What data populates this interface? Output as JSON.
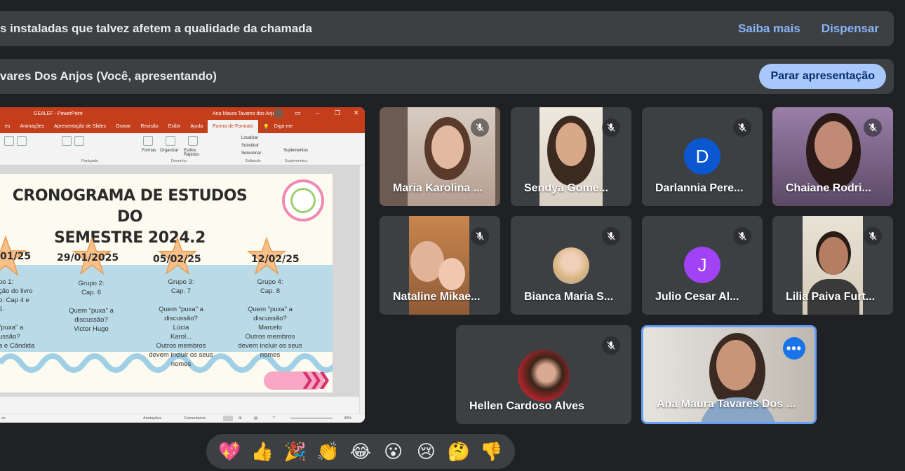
{
  "banner": {
    "message": "s instaladas que talvez afetem a qualidade da chamada",
    "learn_more": "Saiba mais",
    "dismiss": "Dispensar"
  },
  "presentation": {
    "presenter": "vares Dos Anjos (Você, apresentando)",
    "stop_label": "Parar apresentação"
  },
  "shared_screen": {
    "app_title": "GEALEF - PowerPoint",
    "user": "Ana Maura Tavares dos Anjos",
    "menu": [
      "es",
      "Animações",
      "Apresentação de Slides",
      "Gravar",
      "Revisão",
      "Exibir",
      "Ajuda",
      "Forma de Formato",
      "Diga-me"
    ],
    "ribbon_groups": [
      "Parágrafo",
      "Desenho",
      "Editando",
      "Suplementos"
    ],
    "ribbon_labels": {
      "formas": "Formas",
      "organizar": "Organizar",
      "estilos": "Estilos Rápidos",
      "localizar": "Localizar",
      "substituir": "Substituir",
      "selecionar": "Selecionar",
      "suplementos": "Suplementos"
    },
    "slide": {
      "title_line1": "CRONOGRAMA DE ESTUDOS DO",
      "title_line2": "SEMESTRE 2024.2",
      "dates": [
        "01/25",
        "29/01/2025",
        "05/02/25",
        "12/02/25"
      ],
      "col1": [
        "po 1:",
        "ção do livro",
        "o: Cap 4 e",
        "5.",
        "",
        "\"puxa\" a",
        "ussão?",
        "a e Cândida"
      ],
      "col2": [
        "Grupo 2:",
        "Cap. 6",
        "",
        "Quem \"puxa\" a",
        "discussão?",
        "Victor Hugo"
      ],
      "col3": [
        "Grupo 3:",
        "Cap.  7",
        "",
        "Quem \"puxa\" a",
        "discussão?",
        "Lúcia",
        "Karol...",
        "Outros membros",
        "devem incluir os seus",
        "nomes"
      ],
      "col4": [
        "Grupo 4:",
        "Cap. 8",
        "",
        "Quem \"puxa\" a",
        "discussão?",
        "Marcelo",
        "Outros membros",
        "devem incluir os seus",
        "nomes"
      ]
    },
    "status": {
      "left": "es",
      "notes": "Anotações",
      "comments": "Comentários",
      "zoom": "49%"
    }
  },
  "participants": [
    {
      "name": "Maria Karolina ...",
      "muted": true
    },
    {
      "name": "Sendya Gome...",
      "muted": true
    },
    {
      "name": "Darlannia Pere...",
      "initial": "D",
      "muted": true,
      "color": "#0b57d0"
    },
    {
      "name": "Chaiane Rodri...",
      "muted": true
    },
    {
      "name": "Nataline Mikae...",
      "muted": true
    },
    {
      "name": "Bianca Maria S...",
      "muted": true
    },
    {
      "name": "Julio Cesar Al...",
      "initial": "J",
      "muted": true,
      "color": "#a142f4"
    },
    {
      "name": "Lilia Paiva Furt...",
      "muted": true
    },
    {
      "name": "Hellen Cardoso Alves",
      "muted": true
    },
    {
      "name": "Ana Maura Tavares Dos ...",
      "muted": false,
      "more": "•••"
    }
  ],
  "reactions": [
    "💖",
    "👍",
    "🎉",
    "👏",
    "😂",
    "😮",
    "😢",
    "🤔",
    "👎"
  ],
  "colors": {
    "background": "#202124",
    "surface": "#3c4043",
    "accent": "#8ab4f8",
    "stop_button": "#a8c7fa",
    "active_border": "#669df6"
  }
}
